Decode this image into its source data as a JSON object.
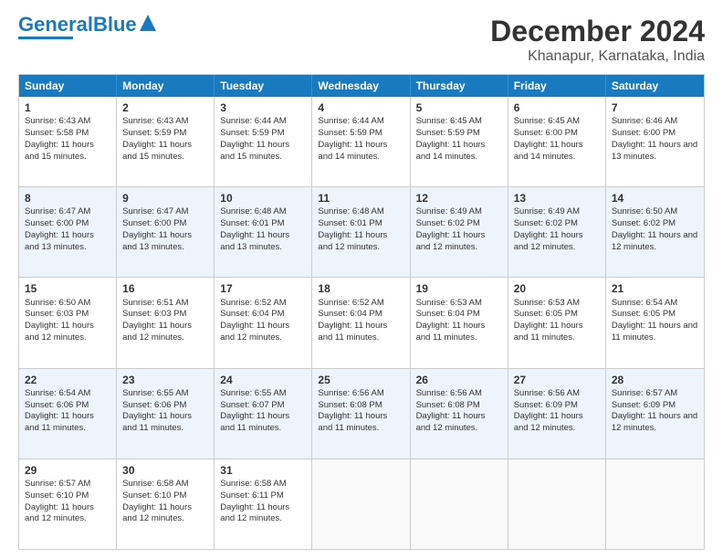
{
  "logo": {
    "part1": "General",
    "part2": "Blue"
  },
  "title": "December 2024",
  "subtitle": "Khanapur, Karnataka, India",
  "days": [
    "Sunday",
    "Monday",
    "Tuesday",
    "Wednesday",
    "Thursday",
    "Friday",
    "Saturday"
  ],
  "weeks": [
    [
      {
        "day": "1",
        "sunrise": "6:43 AM",
        "sunset": "5:58 PM",
        "daylight": "11 hours and 15 minutes."
      },
      {
        "day": "2",
        "sunrise": "6:43 AM",
        "sunset": "5:59 PM",
        "daylight": "11 hours and 15 minutes."
      },
      {
        "day": "3",
        "sunrise": "6:44 AM",
        "sunset": "5:59 PM",
        "daylight": "11 hours and 15 minutes."
      },
      {
        "day": "4",
        "sunrise": "6:44 AM",
        "sunset": "5:59 PM",
        "daylight": "11 hours and 14 minutes."
      },
      {
        "day": "5",
        "sunrise": "6:45 AM",
        "sunset": "5:59 PM",
        "daylight": "11 hours and 14 minutes."
      },
      {
        "day": "6",
        "sunrise": "6:45 AM",
        "sunset": "6:00 PM",
        "daylight": "11 hours and 14 minutes."
      },
      {
        "day": "7",
        "sunrise": "6:46 AM",
        "sunset": "6:00 PM",
        "daylight": "11 hours and 13 minutes."
      }
    ],
    [
      {
        "day": "8",
        "sunrise": "6:47 AM",
        "sunset": "6:00 PM",
        "daylight": "11 hours and 13 minutes."
      },
      {
        "day": "9",
        "sunrise": "6:47 AM",
        "sunset": "6:00 PM",
        "daylight": "11 hours and 13 minutes."
      },
      {
        "day": "10",
        "sunrise": "6:48 AM",
        "sunset": "6:01 PM",
        "daylight": "11 hours and 13 minutes."
      },
      {
        "day": "11",
        "sunrise": "6:48 AM",
        "sunset": "6:01 PM",
        "daylight": "11 hours and 12 minutes."
      },
      {
        "day": "12",
        "sunrise": "6:49 AM",
        "sunset": "6:02 PM",
        "daylight": "11 hours and 12 minutes."
      },
      {
        "day": "13",
        "sunrise": "6:49 AM",
        "sunset": "6:02 PM",
        "daylight": "11 hours and 12 minutes."
      },
      {
        "day": "14",
        "sunrise": "6:50 AM",
        "sunset": "6:02 PM",
        "daylight": "11 hours and 12 minutes."
      }
    ],
    [
      {
        "day": "15",
        "sunrise": "6:50 AM",
        "sunset": "6:03 PM",
        "daylight": "11 hours and 12 minutes."
      },
      {
        "day": "16",
        "sunrise": "6:51 AM",
        "sunset": "6:03 PM",
        "daylight": "11 hours and 12 minutes."
      },
      {
        "day": "17",
        "sunrise": "6:52 AM",
        "sunset": "6:04 PM",
        "daylight": "11 hours and 12 minutes."
      },
      {
        "day": "18",
        "sunrise": "6:52 AM",
        "sunset": "6:04 PM",
        "daylight": "11 hours and 11 minutes."
      },
      {
        "day": "19",
        "sunrise": "6:53 AM",
        "sunset": "6:04 PM",
        "daylight": "11 hours and 11 minutes."
      },
      {
        "day": "20",
        "sunrise": "6:53 AM",
        "sunset": "6:05 PM",
        "daylight": "11 hours and 11 minutes."
      },
      {
        "day": "21",
        "sunrise": "6:54 AM",
        "sunset": "6:05 PM",
        "daylight": "11 hours and 11 minutes."
      }
    ],
    [
      {
        "day": "22",
        "sunrise": "6:54 AM",
        "sunset": "6:06 PM",
        "daylight": "11 hours and 11 minutes."
      },
      {
        "day": "23",
        "sunrise": "6:55 AM",
        "sunset": "6:06 PM",
        "daylight": "11 hours and 11 minutes."
      },
      {
        "day": "24",
        "sunrise": "6:55 AM",
        "sunset": "6:07 PM",
        "daylight": "11 hours and 11 minutes."
      },
      {
        "day": "25",
        "sunrise": "6:56 AM",
        "sunset": "6:08 PM",
        "daylight": "11 hours and 11 minutes."
      },
      {
        "day": "26",
        "sunrise": "6:56 AM",
        "sunset": "6:08 PM",
        "daylight": "11 hours and 12 minutes."
      },
      {
        "day": "27",
        "sunrise": "6:56 AM",
        "sunset": "6:09 PM",
        "daylight": "11 hours and 12 minutes."
      },
      {
        "day": "28",
        "sunrise": "6:57 AM",
        "sunset": "6:09 PM",
        "daylight": "11 hours and 12 minutes."
      }
    ],
    [
      {
        "day": "29",
        "sunrise": "6:57 AM",
        "sunset": "6:10 PM",
        "daylight": "11 hours and 12 minutes."
      },
      {
        "day": "30",
        "sunrise": "6:58 AM",
        "sunset": "6:10 PM",
        "daylight": "11 hours and 12 minutes."
      },
      {
        "day": "31",
        "sunrise": "6:58 AM",
        "sunset": "6:11 PM",
        "daylight": "11 hours and 12 minutes."
      },
      null,
      null,
      null,
      null
    ]
  ],
  "labels": {
    "sunrise": "Sunrise: ",
    "sunset": "Sunset: ",
    "daylight": "Daylight: "
  }
}
